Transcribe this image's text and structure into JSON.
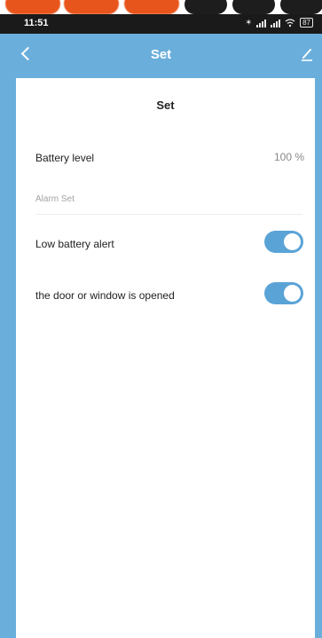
{
  "status_bar": {
    "time": "11:51",
    "battery": "87"
  },
  "header": {
    "title": "Set"
  },
  "card": {
    "title": "Set",
    "battery_label": "Battery level",
    "battery_value": "100 %",
    "section_label": "Alarm Set",
    "low_battery_label": "Low battery alert",
    "low_battery_on": true,
    "door_window_label": "the door or window is  opened",
    "door_window_on": true
  },
  "colors": {
    "header": "#6aaedb",
    "toggle_on": "#5aa3d6"
  }
}
